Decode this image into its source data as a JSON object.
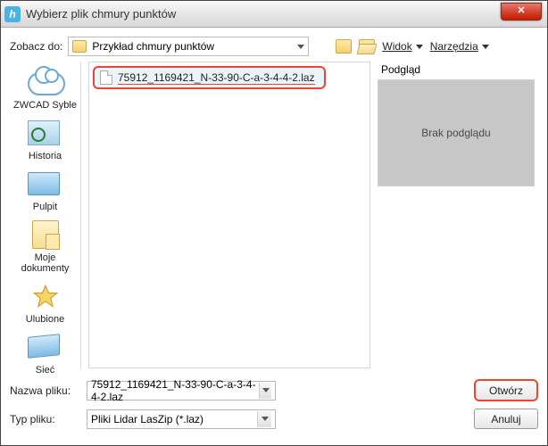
{
  "window": {
    "title": "Wybierz plik chmury punktów"
  },
  "toprow": {
    "look_in_label": "Zobacz do:",
    "folder_name": "Przykład chmury punktów",
    "view_label": "Widok",
    "tools_label": "Narzędzia"
  },
  "sidebar": {
    "items": [
      {
        "label": "ZWCAD Syble"
      },
      {
        "label": "Historia"
      },
      {
        "label": "Pulpit"
      },
      {
        "label": "Moje dokumenty"
      },
      {
        "label": "Ulubione"
      },
      {
        "label": "Sieć"
      }
    ]
  },
  "filelist": {
    "items": [
      {
        "name": "75912_1169421_N-33-90-C-a-3-4-4-2.laz"
      }
    ]
  },
  "preview": {
    "label": "Podgląd",
    "empty_text": "Brak podglądu"
  },
  "bottom": {
    "filename_label": "Nazwa pliku:",
    "filename_value": "75912_1169421_N-33-90-C-a-3-4-4-2.laz",
    "filetype_label": "Typ pliku:",
    "filetype_value": "Pliki Lidar LasZip (*.laz)",
    "open_label": "Otwórz",
    "cancel_label": "Anuluj"
  }
}
